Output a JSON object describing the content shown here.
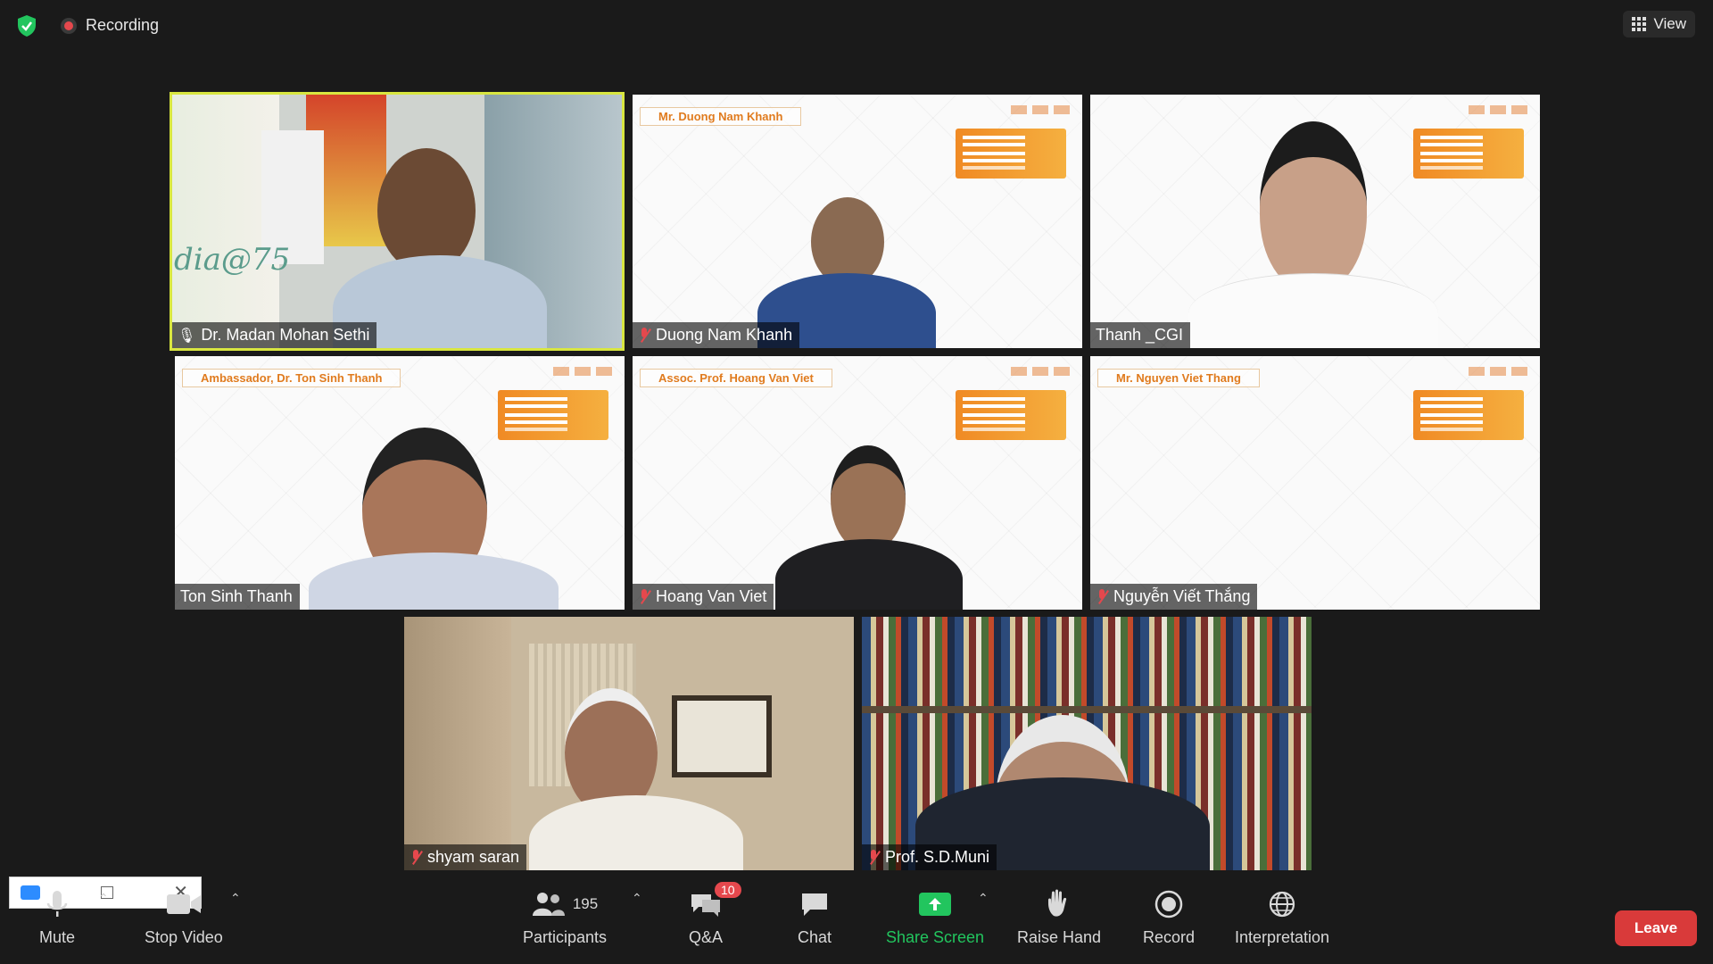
{
  "topbar": {
    "recording_label": "Recording",
    "view_label": "View"
  },
  "participants": [
    {
      "name": "Dr. Madan Mohan Sethi",
      "muted": false,
      "active": true
    },
    {
      "name": "Duong Nam Khanh",
      "muted": true,
      "slide_title": "Mr. Duong Nam Khanh"
    },
    {
      "name": "Thanh _CGI",
      "muted": false
    },
    {
      "name": "Ton Sinh Thanh",
      "muted": false,
      "slide_title": "Ambassador, Dr. Ton Sinh Thanh"
    },
    {
      "name": "Hoang Van Viet",
      "muted": true,
      "slide_title": "Assoc. Prof. Hoang Van Viet"
    },
    {
      "name": "Nguyễn Viết Thắng",
      "muted": true,
      "slide_title": "Mr. Nguyen Viet Thang"
    },
    {
      "name": "shyam saran",
      "muted": true
    },
    {
      "name": "Prof. S.D.Muni",
      "muted": true
    }
  ],
  "toolbar": {
    "mute": "Mute",
    "stop_video": "Stop Video",
    "participants": "Participants",
    "participant_count": "195",
    "qa": "Q&A",
    "qa_badge": "10",
    "chat": "Chat",
    "share_screen": "Share Screen",
    "raise_hand": "Raise Hand",
    "record": "Record",
    "interpretation": "Interpretation",
    "leave": "Leave"
  },
  "colors": {
    "active_speaker": "#d8e640",
    "share_green": "#22c55e",
    "leave_red": "#d93a3a",
    "muted_red": "#e5484d"
  }
}
